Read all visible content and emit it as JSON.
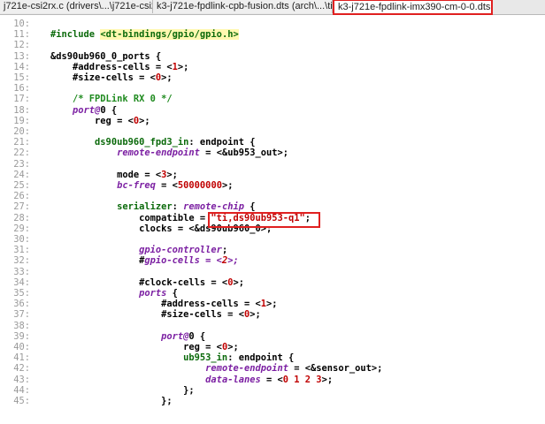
{
  "tabs": [
    {
      "label": "j721e-csi2rx.c (drivers\\...\\j721e-csi2rx)",
      "active": false
    },
    {
      "label": "k3-j721e-fpdlink-cpb-fusion.dts (arch\\...\\ti)",
      "active": false
    },
    {
      "label": "k3-j721e-fpdlink-imx390-cm-0-0.dts (arch\\...\\ti)",
      "active": true
    }
  ],
  "colors": {
    "highlight_box": "#e02020",
    "line_number": "#9a9a9a",
    "keyword": "#7b1fa2",
    "number": "#c00000",
    "comment": "#1e8a1e"
  },
  "editor": {
    "lines": [
      {
        "n": "10:",
        "t": ""
      },
      {
        "n": "11:",
        "t": "#include <dt-bindings/gpio/gpio.h>"
      },
      {
        "n": "12:",
        "t": ""
      },
      {
        "n": "13:",
        "t": "&ds90ub960_0_ports {"
      },
      {
        "n": "14:",
        "t": "    #address-cells = <1>;"
      },
      {
        "n": "15:",
        "t": "    #size-cells = <0>;"
      },
      {
        "n": "16:",
        "t": ""
      },
      {
        "n": "17:",
        "t": "    /* FPDLink RX 0 */"
      },
      {
        "n": "18:",
        "t": "    port@0 {"
      },
      {
        "n": "19:",
        "t": "        reg = <0>;"
      },
      {
        "n": "20:",
        "t": ""
      },
      {
        "n": "21:",
        "t": "        ds90ub960_fpd3_in: endpoint {"
      },
      {
        "n": "22:",
        "t": "            remote-endpoint = <&ub953_out>;"
      },
      {
        "n": "23:",
        "t": ""
      },
      {
        "n": "24:",
        "t": "            mode = <3>;"
      },
      {
        "n": "25:",
        "t": "            bc-freq = <50000000>;"
      },
      {
        "n": "26:",
        "t": ""
      },
      {
        "n": "27:",
        "t": "            serializer: remote-chip {"
      },
      {
        "n": "28:",
        "t": "                compatible = \"ti,ds90ub953-q1\";"
      },
      {
        "n": "29:",
        "t": "                clocks = <&ds90ub960_0>;"
      },
      {
        "n": "30:",
        "t": ""
      },
      {
        "n": "31:",
        "t": "                gpio-controller;"
      },
      {
        "n": "32:",
        "t": "                #gpio-cells = <2>;"
      },
      {
        "n": "33:",
        "t": ""
      },
      {
        "n": "34:",
        "t": "                #clock-cells = <0>;"
      },
      {
        "n": "35:",
        "t": "                ports {"
      },
      {
        "n": "36:",
        "t": "                    #address-cells = <1>;"
      },
      {
        "n": "37:",
        "t": "                    #size-cells = <0>;"
      },
      {
        "n": "38:",
        "t": ""
      },
      {
        "n": "39:",
        "t": "                    port@0 {"
      },
      {
        "n": "40:",
        "t": "                        reg = <0>;"
      },
      {
        "n": "41:",
        "t": "                        ub953_in: endpoint {"
      },
      {
        "n": "42:",
        "t": "                            remote-endpoint = <&sensor_out>;"
      },
      {
        "n": "43:",
        "t": "                            data-lanes = <0 1 2 3>;"
      },
      {
        "n": "44:",
        "t": "                        };"
      },
      {
        "n": "45:",
        "t": "                    };"
      }
    ]
  }
}
